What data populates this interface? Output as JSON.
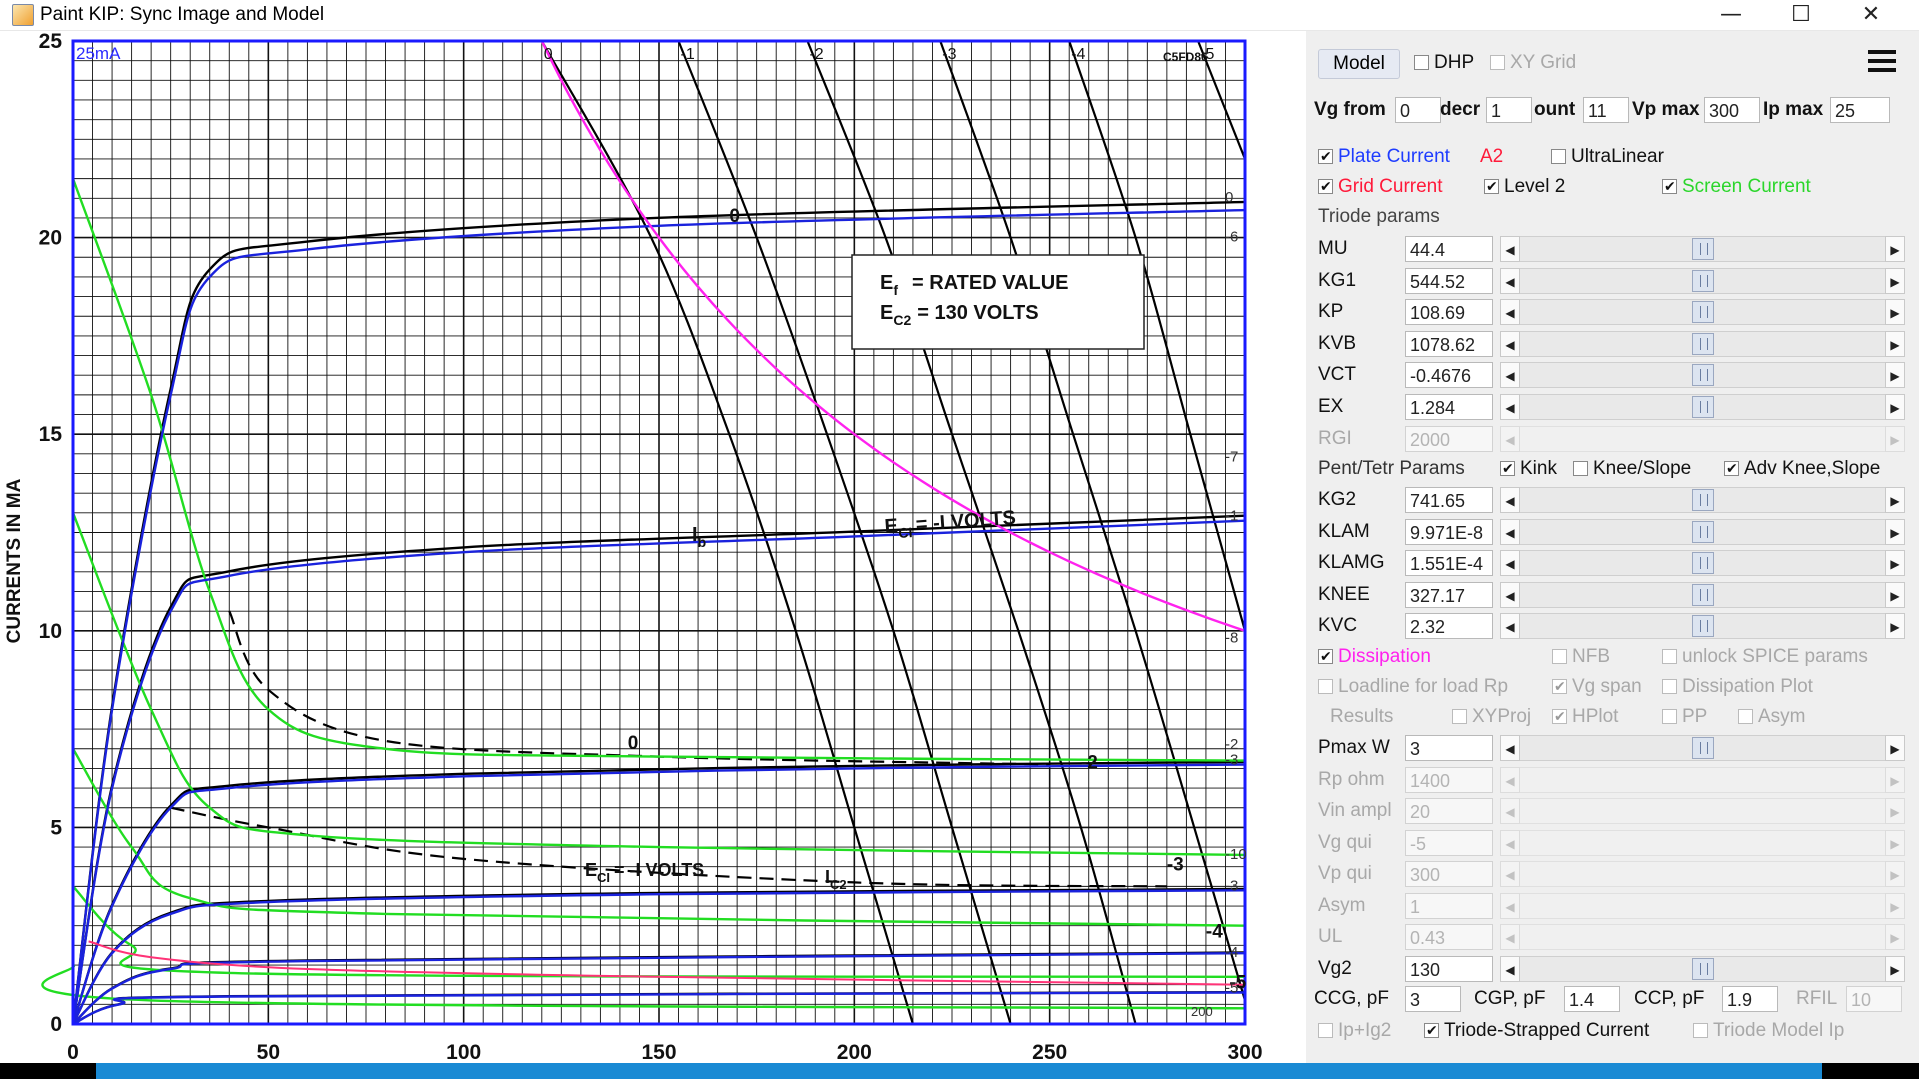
{
  "window": {
    "title": "Paint KIP: Sync Image and Model",
    "controls": [
      "—",
      "☐",
      "✕"
    ]
  },
  "plot": {
    "ylabel": "CURRENTS IN MA",
    "corner_label": "25mA",
    "tube_label": "C5FD86",
    "box_line1": "E",
    "box_line1_sub": "f",
    "box_line1_rest": "= RATED VALUE",
    "box_line2": "E",
    "box_line2_sub": "C2",
    "box_line2_rest": "= 130 VOLTS",
    "ann_ec1_a": "E",
    "ann_ec1_a_sub": "CI",
    "ann_ec1_a_rest": "= -I VOLTS",
    "ann_ec1_b": "E",
    "ann_ec1_b_sub": "CI",
    "ann_ec1_b_rest": "= -I VOLTS",
    "ann_ib": "I",
    "ann_ib_sub": "b",
    "ann_ic2": "I",
    "ann_ic2_sub": "C2",
    "curve_labels": [
      "0",
      "0",
      "-2",
      "-3",
      "-4",
      "-5"
    ],
    "top_grid_labels": [
      "0",
      "-1",
      "-2",
      "-3",
      "-4",
      "-5"
    ],
    "right_labels": [
      "0",
      "-6",
      "-7",
      "-1",
      "-8",
      "-2",
      "-3",
      "-10",
      "-3",
      "-4",
      "-5"
    ],
    "bottom_right_label": "200"
  },
  "chart_data": {
    "type": "line",
    "title": "",
    "xlabel": "",
    "ylabel": "CURRENTS IN MA",
    "xlim": [
      0,
      300
    ],
    "ylim": [
      0,
      25
    ],
    "x_ticks": [
      "0",
      "50",
      "100",
      "150",
      "200",
      "250",
      "300"
    ],
    "y_ticks": [
      "0",
      "5",
      "10",
      "15",
      "20",
      "25"
    ],
    "grid": true,
    "dissipation_watts": 3,
    "black_load_curves": [
      {
        "label": "0",
        "points": [
          [
            120,
            25
          ],
          [
            148,
            20
          ],
          [
            168,
            15
          ],
          [
            185,
            10
          ],
          [
            200,
            5
          ],
          [
            215,
            0
          ]
        ]
      },
      {
        "label": "-1",
        "points": [
          [
            155,
            25
          ],
          [
            175,
            20
          ],
          [
            193,
            15
          ],
          [
            210,
            10
          ],
          [
            225,
            5
          ],
          [
            240,
            0
          ]
        ]
      },
      {
        "label": "-2",
        "points": [
          [
            188,
            25
          ],
          [
            208,
            20
          ],
          [
            225,
            15
          ],
          [
            242,
            10
          ],
          [
            258,
            5
          ],
          [
            272,
            0
          ]
        ]
      },
      {
        "label": "-3",
        "points": [
          [
            222,
            25
          ],
          [
            240,
            20
          ],
          [
            256,
            15
          ],
          [
            272,
            10
          ],
          [
            287,
            5
          ],
          [
            300,
            0.6
          ]
        ]
      },
      {
        "label": "-4",
        "points": [
          [
            255,
            25
          ],
          [
            272,
            20
          ],
          [
            286,
            15
          ],
          [
            300,
            10
          ]
        ]
      },
      {
        "label": "-5",
        "points": [
          [
            288,
            25
          ],
          [
            300,
            22
          ]
        ]
      }
    ],
    "plate_current_curves": [
      {
        "label": "0",
        "points": [
          [
            0,
            0
          ],
          [
            10,
            8
          ],
          [
            25,
            16
          ],
          [
            35,
            19
          ],
          [
            60,
            19.7
          ],
          [
            150,
            20.3
          ],
          [
            300,
            20.7
          ]
        ]
      },
      {
        "label": "-1",
        "points": [
          [
            0,
            0
          ],
          [
            10,
            6
          ],
          [
            25,
            10.5
          ],
          [
            40,
            11.4
          ],
          [
            100,
            12
          ],
          [
            200,
            12.4
          ],
          [
            300,
            12.8
          ]
        ]
      },
      {
        "label": "-2",
        "points": [
          [
            0,
            0
          ],
          [
            10,
            3
          ],
          [
            25,
            5.5
          ],
          [
            40,
            6
          ],
          [
            100,
            6.3
          ],
          [
            200,
            6.5
          ],
          [
            300,
            6.6
          ]
        ]
      },
      {
        "label": "-3",
        "points": [
          [
            0,
            0
          ],
          [
            10,
            1.8
          ],
          [
            25,
            2.8
          ],
          [
            50,
            3.1
          ],
          [
            150,
            3.3
          ],
          [
            300,
            3.4
          ]
        ]
      },
      {
        "label": "-4",
        "points": [
          [
            0,
            0
          ],
          [
            10,
            0.9
          ],
          [
            25,
            1.4
          ],
          [
            60,
            1.6
          ],
          [
            300,
            1.8
          ]
        ]
      },
      {
        "label": "-5",
        "points": [
          [
            0,
            0
          ],
          [
            12,
            0.5
          ],
          [
            40,
            0.7
          ],
          [
            300,
            0.8
          ]
        ]
      }
    ],
    "screen_current_curves": [
      {
        "label": "0",
        "points": [
          [
            0,
            21.5
          ],
          [
            20,
            16
          ],
          [
            35,
            11
          ],
          [
            50,
            8
          ],
          [
            80,
            7
          ],
          [
            150,
            6.8
          ],
          [
            300,
            6.7
          ]
        ]
      },
      {
        "label": "-1",
        "points": [
          [
            0,
            13
          ],
          [
            20,
            8
          ],
          [
            35,
            5.5
          ],
          [
            60,
            4.8
          ],
          [
            150,
            4.5
          ],
          [
            300,
            4.3
          ]
        ]
      },
      {
        "label": "-2",
        "points": [
          [
            0,
            7
          ],
          [
            15,
            4.5
          ],
          [
            30,
            3.2
          ],
          [
            80,
            2.8
          ],
          [
            300,
            2.5
          ]
        ]
      },
      {
        "label": "-3",
        "points": [
          [
            0,
            3.5
          ],
          [
            15,
            2
          ],
          [
            40,
            1.3
          ],
          [
            300,
            1.2
          ]
        ]
      },
      {
        "label": "-4",
        "points": [
          [
            0,
            1.5
          ],
          [
            20,
            0.6
          ],
          [
            300,
            0.4
          ]
        ]
      }
    ],
    "dashed_screen_curves": [
      {
        "label": "0",
        "points": [
          [
            40,
            10.5
          ],
          [
            50,
            8.5
          ],
          [
            80,
            7.2
          ],
          [
            150,
            6.8
          ],
          [
            250,
            6.6
          ]
        ]
      },
      {
        "label": "-1",
        "points": [
          [
            25,
            5.5
          ],
          [
            50,
            5
          ],
          [
            100,
            4.2
          ],
          [
            200,
            3.6
          ],
          [
            280,
            3.5
          ]
        ]
      }
    ]
  },
  "panel": {
    "model_button": "Model",
    "dhp": "DHP",
    "xy_grid": "XY Grid",
    "vg_from_label": "Vg from",
    "vg_from": "0",
    "decr_label": "decr",
    "decr": "1",
    "count_label": "ount",
    "count": "11",
    "vpmax_label": "Vp max",
    "vpmax": "300",
    "ipmax_label": "Ip max",
    "ipmax": "25",
    "plate_current": "Plate Current",
    "a2": "A2",
    "ultralinear": "UltraLinear",
    "grid_current": "Grid Current",
    "level2": "Level 2",
    "screen_current": "Screen Current",
    "triode_params": "Triode params",
    "params": [
      {
        "label": "MU",
        "value": "44.4"
      },
      {
        "label": "KG1",
        "value": "544.52"
      },
      {
        "label": "KP",
        "value": "108.69"
      },
      {
        "label": "KVB",
        "value": "1078.62"
      },
      {
        "label": "VCT",
        "value": "-0.4676"
      },
      {
        "label": "EX",
        "value": "1.284"
      },
      {
        "label": "RGI",
        "value": "2000"
      }
    ],
    "pent_params": "Pent/Tetr Params",
    "kink": "Kink",
    "knee_slope": "Knee/Slope",
    "adv_knee": "Adv Knee,Slope",
    "params2": [
      {
        "label": "KG2",
        "value": "741.65"
      },
      {
        "label": "KLAM",
        "value": "9.971E-8"
      },
      {
        "label": "KLAMG",
        "value": "1.551E-4"
      },
      {
        "label": "KNEE",
        "value": "327.17"
      },
      {
        "label": "KVC",
        "value": "2.32"
      }
    ],
    "dissipation": "Dissipation",
    "nfb": "NFB",
    "unlock_spice": "unlock SPICE params",
    "loadline": "Loadline for load Rp",
    "vg_span": "Vg span",
    "dissipation_plot": "Dissipation Plot",
    "results": "Results",
    "xyproj": "XYProj",
    "hplot": "HPlot",
    "pp": "PP",
    "asym_cb": "Asym",
    "params3": [
      {
        "label": "Pmax W",
        "value": "3"
      },
      {
        "label": "Rp ohm",
        "value": "1400"
      },
      {
        "label": "Vin ampl",
        "value": "20"
      },
      {
        "label": "Vg qui",
        "value": "-5"
      },
      {
        "label": "Vp qui",
        "value": "300"
      },
      {
        "label": "Asym",
        "value": "1"
      },
      {
        "label": "UL",
        "value": "0.43"
      },
      {
        "label": "Vg2",
        "value": "130"
      }
    ],
    "ccg_label": "CCG, pF",
    "ccg": "3",
    "cgp_label": "CGP, pF",
    "cgp": "1.4",
    "ccp_label": "CCP, pF",
    "ccp": "1.9",
    "rfil_label": "RFIL",
    "rfil": "10",
    "ipig2": "Ip+Ig2",
    "triode_strapped": "Triode-Strapped Current",
    "triode_model_ip": "Triode Model Ip"
  },
  "colors": {
    "plot_frame": "#1a1aff",
    "plate_model": "#1a22dd",
    "screen_model": "#22dd22",
    "dissipation": "#ff22ee",
    "image_curve": "#000000",
    "pink_line": "#ff3377"
  }
}
